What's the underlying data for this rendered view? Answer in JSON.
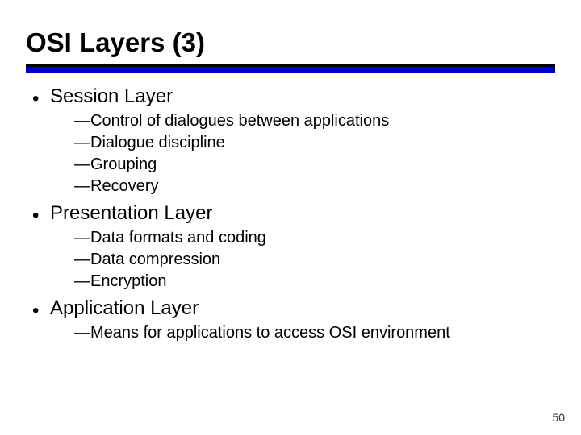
{
  "title": "OSI Layers (3)",
  "sections": [
    {
      "heading": "Session Layer",
      "items": [
        "Control of dialogues between applications",
        "Dialogue discipline",
        "Grouping",
        "Recovery"
      ]
    },
    {
      "heading": "Presentation Layer",
      "items": [
        "Data formats and coding",
        "Data compression",
        "Encryption"
      ]
    },
    {
      "heading": "Application Layer",
      "items": [
        "Means for applications to access OSI environment"
      ]
    }
  ],
  "page_number": "50",
  "glyphs": {
    "bullet": "•",
    "dash": "—"
  }
}
